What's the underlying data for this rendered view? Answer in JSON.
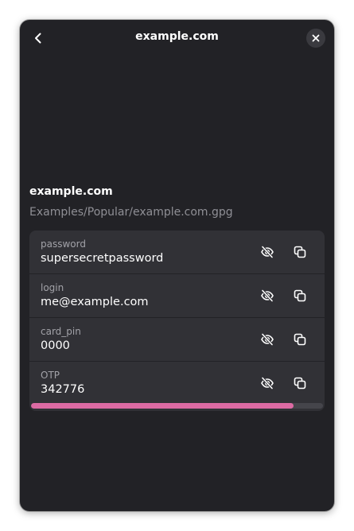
{
  "header": {
    "title": "example.com",
    "back_icon": "go-back-icon",
    "close_icon": "close-icon"
  },
  "entry": {
    "name": "example.com",
    "path": "Examples/Popular/example.com.gpg"
  },
  "fields": [
    {
      "label": "password",
      "value": "supersecretpassword"
    },
    {
      "label": "login",
      "value": "me@example.com"
    },
    {
      "label": "card_pin",
      "value": "0000"
    },
    {
      "label": "OTP",
      "value": "342776"
    }
  ],
  "otp": {
    "remaining_fraction": 0.9
  },
  "colors": {
    "window_bg": "#222226",
    "card_bg": "#313136",
    "accent": "#dc6aa3",
    "dim_text": "#8f8f95"
  }
}
